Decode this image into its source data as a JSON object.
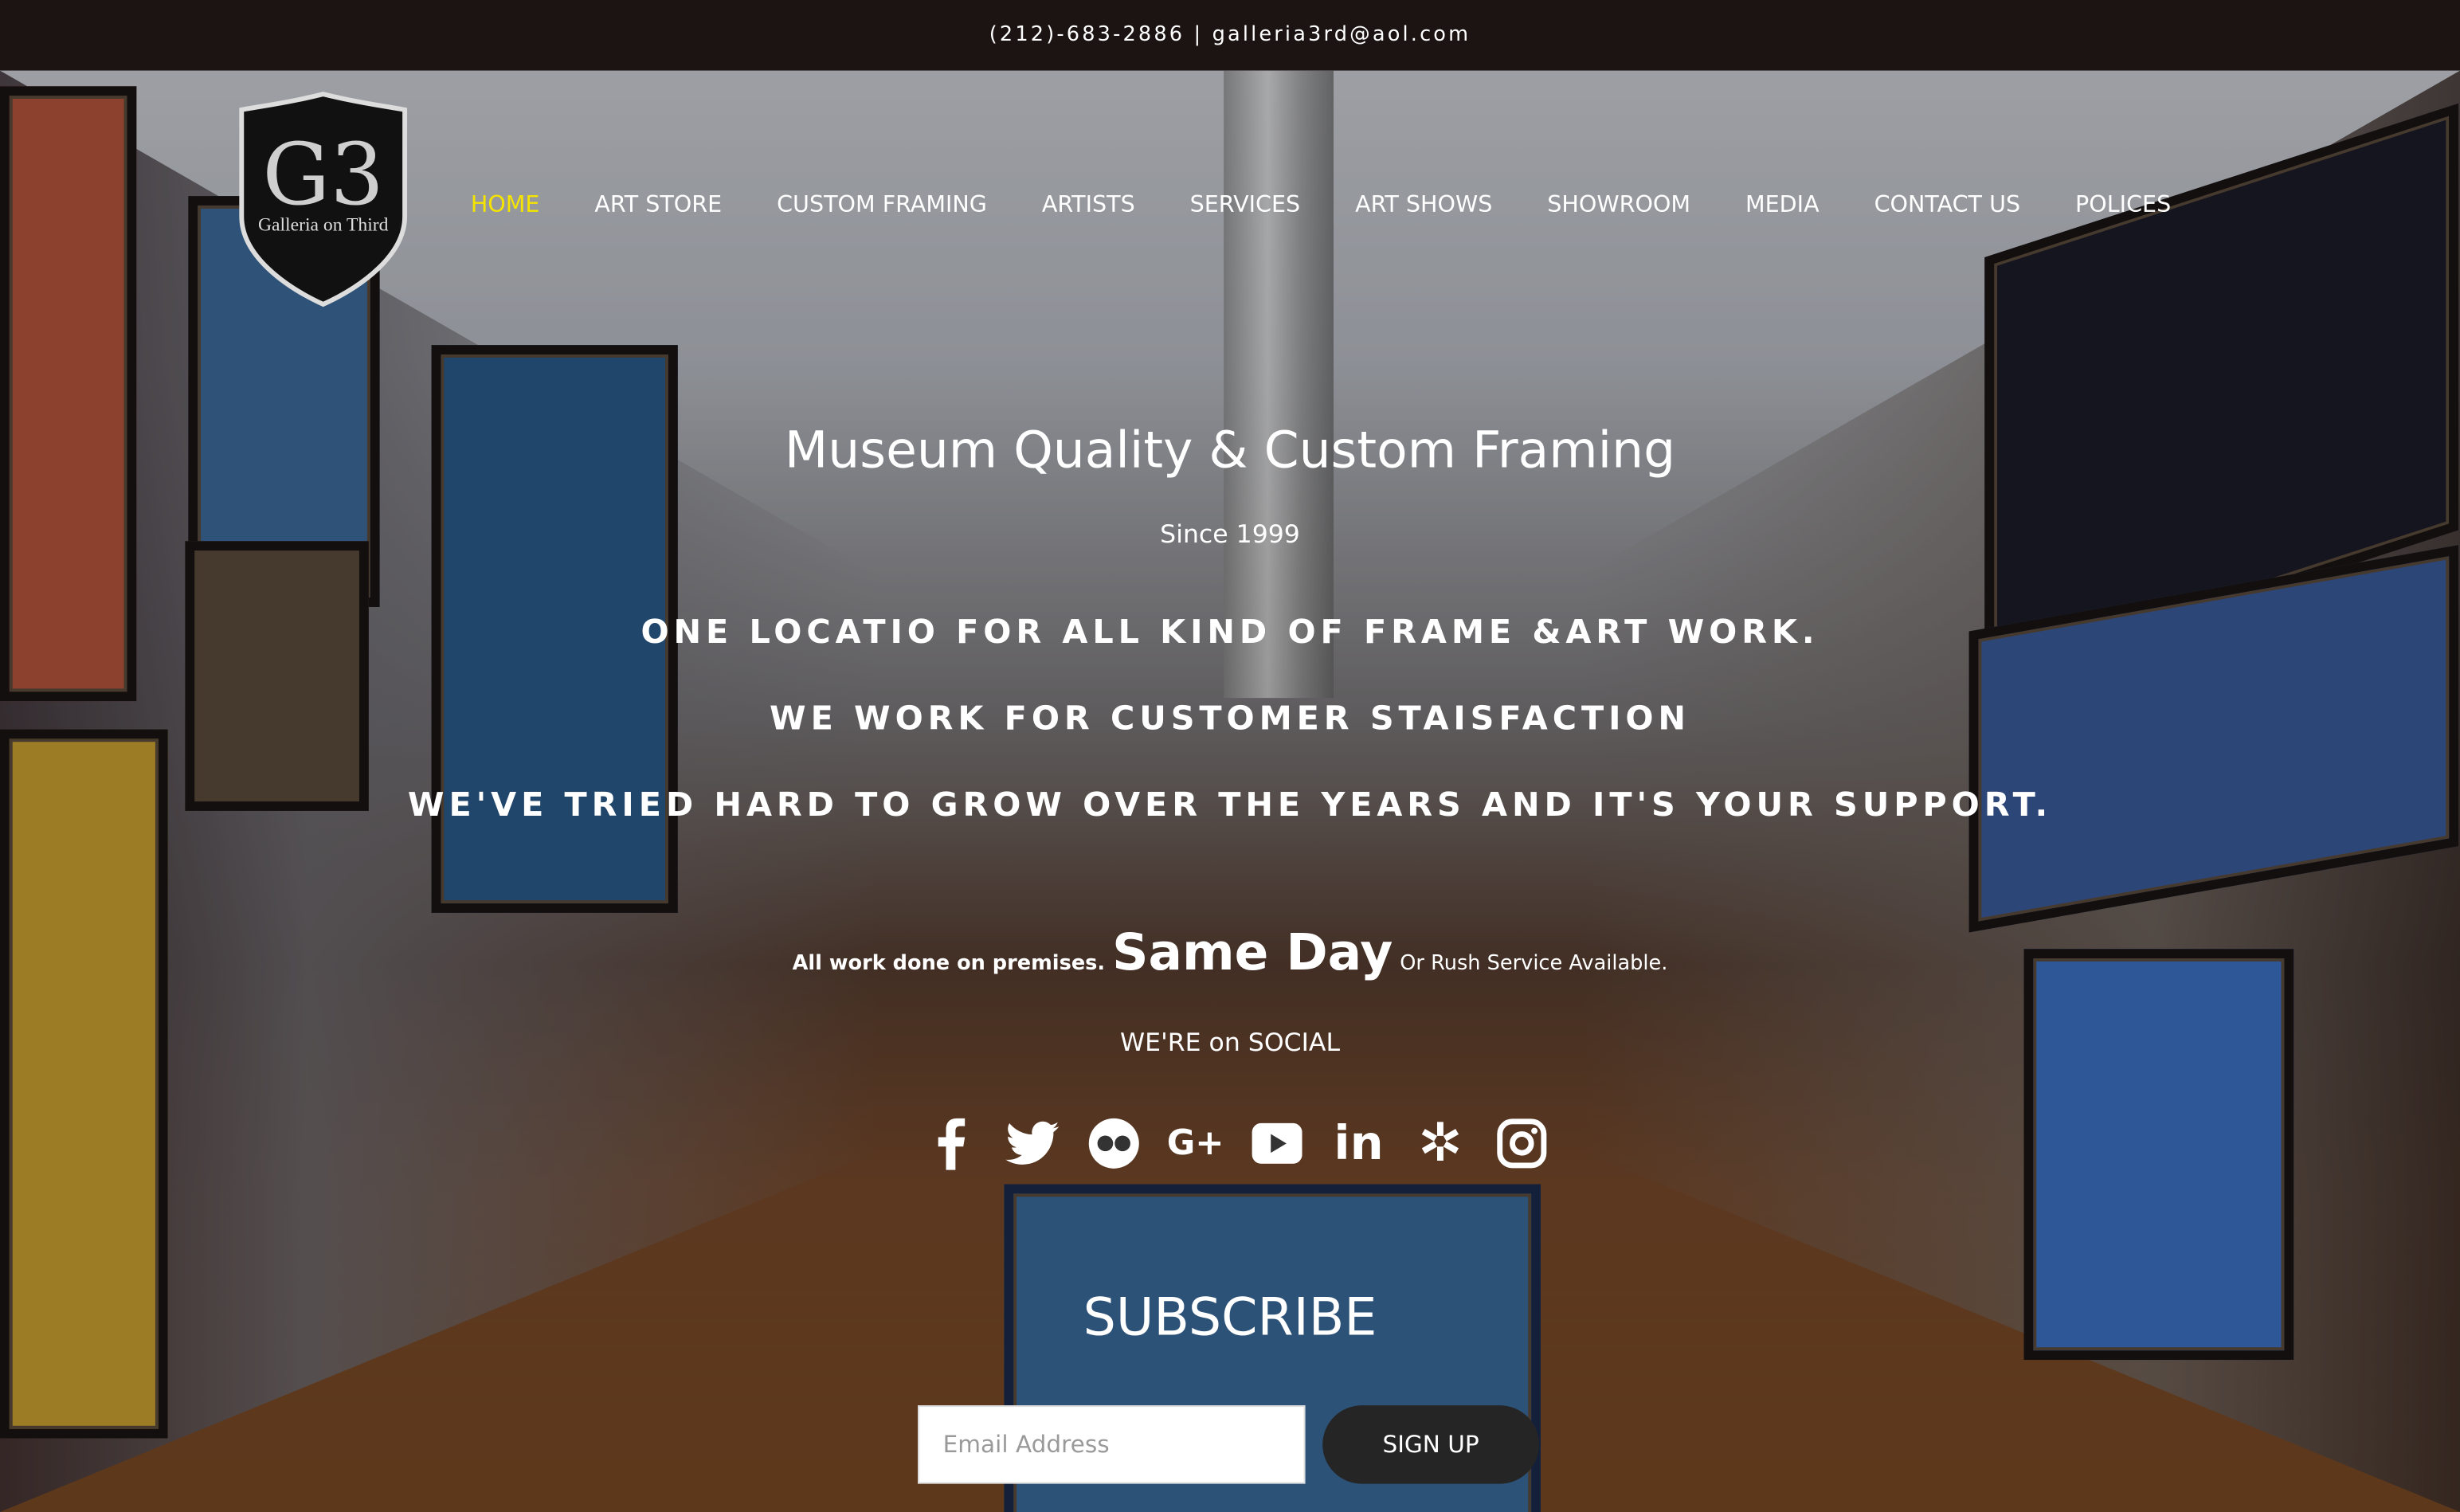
{
  "topbar": {
    "contact": "(212)-683-2886 | galleria3rd@aol.com"
  },
  "logo": {
    "monogram": "G3",
    "name": "Galleria on Third"
  },
  "nav": {
    "items": [
      {
        "label": "HOME",
        "active": true
      },
      {
        "label": "ART STORE"
      },
      {
        "label": "CUSTOM FRAMING"
      },
      {
        "label": "ARTISTS"
      },
      {
        "label": "SERVICES"
      },
      {
        "label": "ART SHOWS"
      },
      {
        "label": "SHOWROOM"
      },
      {
        "label": "MEDIA"
      },
      {
        "label": "CONTACT US"
      },
      {
        "label": "POLICES"
      }
    ],
    "active_color": "#f5e400"
  },
  "hero": {
    "title": "Museum Quality & Custom Framing",
    "since": "Since 1999",
    "taglines": [
      "ONE LOCATIO FOR ALL KIND OF FRAME &ART WORK.",
      "WE WORK FOR CUSTOMER STAISFACTION",
      "WE'VE TRIED HARD TO GROW OVER THE YEARS AND IT'S YOUR SUPPORT."
    ],
    "premises": "All work done on premises.",
    "same_day": "Same Day",
    "rush": "Or Rush Service Available."
  },
  "social": {
    "title": "WE'RE on SOCIAL",
    "icons": [
      "facebook-icon",
      "twitter-icon",
      "flickr-icon",
      "google-plus-icon",
      "youtube-icon",
      "linkedin-icon",
      "yelp-icon",
      "instagram-icon"
    ]
  },
  "subscribe": {
    "title": "SUBSCRIBE",
    "email_placeholder": "Email Address",
    "email_value": "",
    "button": "SIGN UP"
  }
}
